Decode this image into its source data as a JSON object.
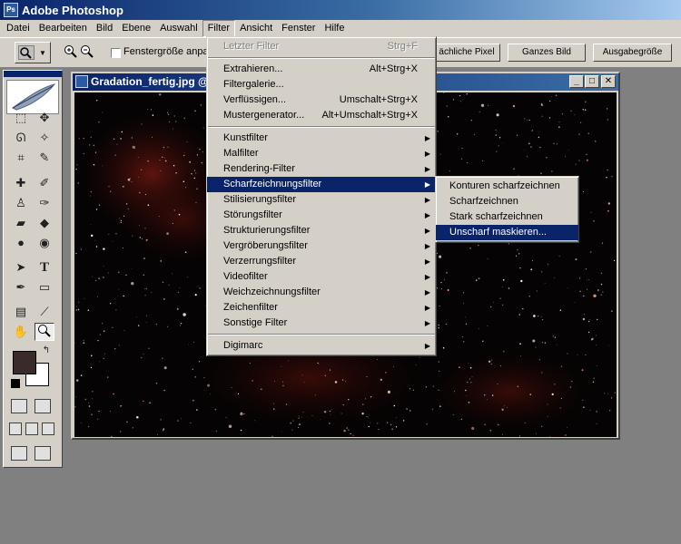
{
  "app": {
    "title": "Adobe Photoshop"
  },
  "menubar": {
    "items": [
      {
        "label": "Datei"
      },
      {
        "label": "Bearbeiten"
      },
      {
        "label": "Bild"
      },
      {
        "label": "Ebene"
      },
      {
        "label": "Auswahl"
      },
      {
        "label": "Filter"
      },
      {
        "label": "Ansicht"
      },
      {
        "label": "Fenster"
      },
      {
        "label": "Hilfe"
      }
    ],
    "open_menu": "Filter"
  },
  "options_bar": {
    "tool_icon": "zoom-tool-icon",
    "zoom_in_icon": "zoom-in-icon",
    "zoom_out_icon": "zoom-out-icon",
    "resize_window_label": "Fenstergröße anpas",
    "actual_pixels_label": "ächliche Pixel",
    "fit_screen_label": "Ganzes Bild",
    "print_size_label": "Ausgabegröße"
  },
  "document": {
    "title": "Gradation_fertig.jpg @",
    "minimize": "_",
    "maximize": "□",
    "close": "✕"
  },
  "filter_menu": {
    "last_filter": {
      "label": "Letzter Filter",
      "shortcut": "Strg+F"
    },
    "group1": [
      {
        "label": "Extrahieren...",
        "shortcut": "Alt+Strg+X"
      },
      {
        "label": "Filtergalerie...",
        "shortcut": ""
      },
      {
        "label": "Verflüssigen...",
        "shortcut": "Umschalt+Strg+X"
      },
      {
        "label": "Mustergenerator...",
        "shortcut": "Alt+Umschalt+Strg+X"
      }
    ],
    "group2": [
      {
        "label": "Kunstfilter"
      },
      {
        "label": "Malfilter"
      },
      {
        "label": "Rendering-Filter"
      },
      {
        "label": "Scharfzeichnungsfilter"
      },
      {
        "label": "Stilisierungsfilter"
      },
      {
        "label": "Störungsfilter"
      },
      {
        "label": "Strukturierungsfilter"
      },
      {
        "label": "Vergröberungsfilter"
      },
      {
        "label": "Verzerrungsfilter"
      },
      {
        "label": "Videofilter"
      },
      {
        "label": "Weichzeichnungsfilter"
      },
      {
        "label": "Zeichenfilter"
      },
      {
        "label": "Sonstige Filter"
      }
    ],
    "group3": [
      {
        "label": "Digimarc"
      }
    ],
    "highlighted": "Scharfzeichnungsfilter"
  },
  "sharpen_submenu": {
    "items": [
      {
        "label": "Konturen scharfzeichnen"
      },
      {
        "label": "Scharfzeichnen"
      },
      {
        "label": "Stark scharfzeichnen"
      },
      {
        "label": "Unscharf maskieren..."
      }
    ],
    "highlighted": "Unscharf maskieren..."
  },
  "colors": {
    "foreground": "#3a2a2a",
    "background": "#ffffff",
    "menu_highlight": "#0a246a"
  }
}
